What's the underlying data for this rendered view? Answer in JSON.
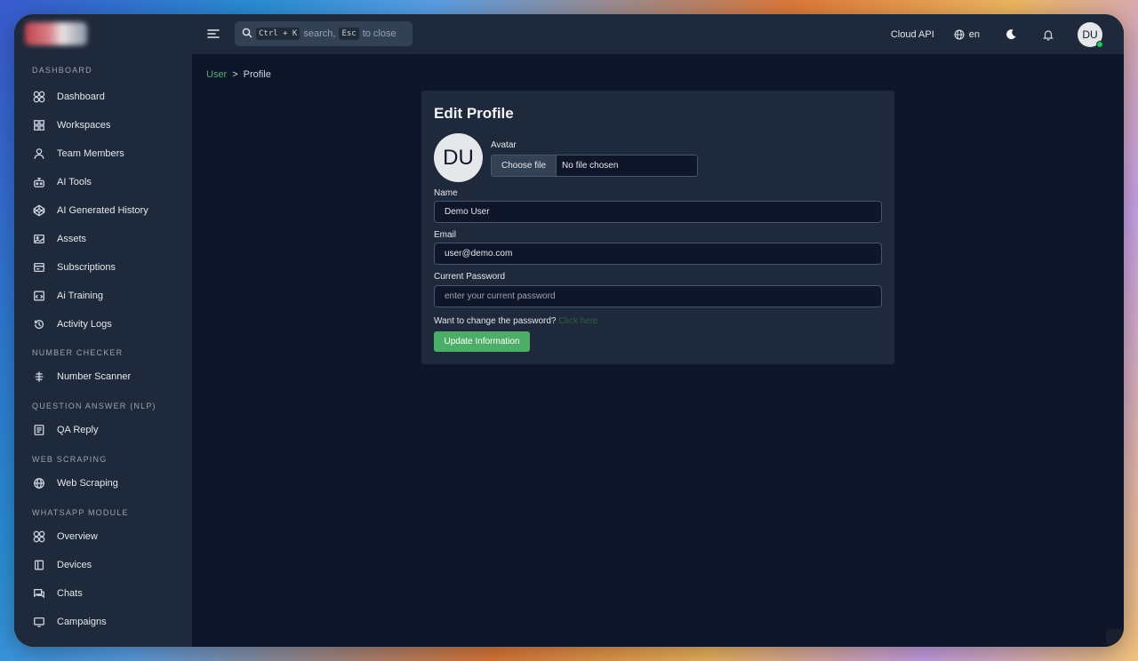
{
  "topbar": {
    "search_shortcut": "Ctrl + K",
    "search_text": "search,",
    "search_esc": "Esc",
    "search_close": "to close",
    "cloud_api": "Cloud API",
    "language": "en",
    "avatar_initials": "DU"
  },
  "sidebar": {
    "sections": [
      {
        "title": "DASHBOARD",
        "items": [
          {
            "label": "Dashboard",
            "icon": "grid-circles-icon"
          },
          {
            "label": "Workspaces",
            "icon": "grid-squares-icon"
          },
          {
            "label": "Team Members",
            "icon": "user-icon"
          },
          {
            "label": "AI Tools",
            "icon": "robot-icon"
          },
          {
            "label": "AI Generated History",
            "icon": "codepen-icon"
          },
          {
            "label": "Assets",
            "icon": "image-icon"
          },
          {
            "label": "Subscriptions",
            "icon": "receipt-icon"
          },
          {
            "label": "Ai Training",
            "icon": "code-window-icon"
          },
          {
            "label": "Activity Logs",
            "icon": "history-icon"
          }
        ]
      },
      {
        "title": "NUMBER CHECKER",
        "items": [
          {
            "label": "Number Scanner",
            "icon": "scanner-icon"
          }
        ]
      },
      {
        "title": "QUESTION ANSWER (NLP)",
        "items": [
          {
            "label": "QA Reply",
            "icon": "document-icon"
          }
        ]
      },
      {
        "title": "WEB SCRAPING",
        "items": [
          {
            "label": "Web Scraping",
            "icon": "globe-icon"
          }
        ]
      },
      {
        "title": "WHATSAPP MODULE",
        "items": [
          {
            "label": "Overview",
            "icon": "grid-circles-icon"
          },
          {
            "label": "Devices",
            "icon": "devices-icon"
          },
          {
            "label": "Chats",
            "icon": "chat-icon"
          },
          {
            "label": "Campaigns",
            "icon": "monitor-icon"
          }
        ]
      }
    ]
  },
  "breadcrumb": {
    "parent": "User",
    "separator": ">",
    "current": "Profile"
  },
  "profile_form": {
    "title": "Edit Profile",
    "avatar_initials": "DU",
    "avatar_label": "Avatar",
    "file_button": "Choose file",
    "file_status": "No file chosen",
    "name_label": "Name",
    "name_value": "Demo User",
    "email_label": "Email",
    "email_value": "user@demo.com",
    "password_label": "Current Password",
    "password_placeholder": "enter your current password",
    "change_password_text": "Want to change the password?",
    "click_here": "Click here",
    "submit_label": "Update Information"
  },
  "colors": {
    "accent_green": "#4cae66",
    "panel": "#1e293b",
    "background": "#0f1629"
  }
}
